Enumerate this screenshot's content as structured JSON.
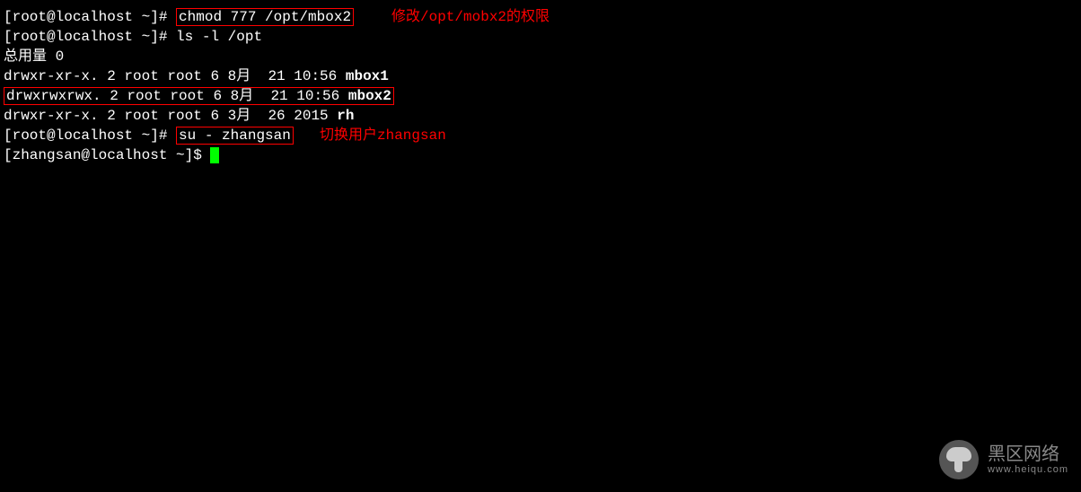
{
  "lines": {
    "l1_prompt": "[root@localhost ~]# ",
    "l1_cmd": "chmod 777 /opt/mbox2",
    "l2_prompt": "[root@localhost ~]# ",
    "l2_cmd": "ls -l /opt",
    "l3": "总用量 0",
    "l4_a": "drwxr-xr-x. 2 root root 6 8月  21 10:56 ",
    "l4_b": "mbox1",
    "l5_a": "drwxrwxrwx. 2 root root 6 8月  21 10:56 ",
    "l5_b": "mbox2",
    "l6_a": "drwxr-xr-x. 2 root root 6 3月  26 2015 ",
    "l6_b": "rh",
    "l7_prompt": "[root@localhost ~]# ",
    "l7_cmd": "su - zhangsan",
    "l8_prompt": "[zhangsan@localhost ~]$ "
  },
  "annotations": {
    "a1": "修改/opt/mobx2的权限",
    "a2": "切换用户zhangsan"
  },
  "watermark": {
    "title": "黑区网络",
    "sub": "www.heiqu.com"
  }
}
